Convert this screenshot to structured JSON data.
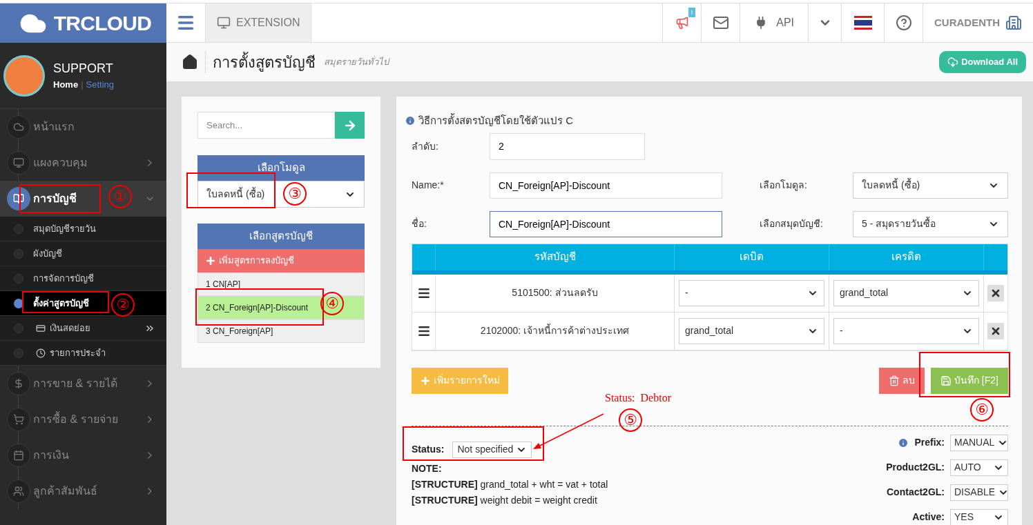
{
  "brand": {
    "name": "TRCLOUD"
  },
  "topbar": {
    "tab": "EXTENSION",
    "notification_badge": "!",
    "api_label": "API",
    "company": "CURADENTH"
  },
  "profile": {
    "name": "SUPPORT",
    "separator": "|",
    "links": [
      {
        "label": "Home",
        "selected": true
      },
      {
        "label": "Setting",
        "selected": false
      }
    ]
  },
  "sidebar": {
    "items": [
      {
        "label": "หน้าแรก",
        "expanded": false,
        "has_arrow": false
      },
      {
        "label": "แผงควบคุม",
        "expanded": false,
        "has_arrow": true
      },
      {
        "label": "การบัญชี",
        "expanded": true,
        "has_arrow": true,
        "children": [
          {
            "label": "สมุดบัญชีรายวัน",
            "selected": false,
            "kind": "plain"
          },
          {
            "label": "ผังบัญชี",
            "selected": false,
            "kind": "plain"
          },
          {
            "label": "การจัดการบัญชี",
            "selected": false,
            "kind": "plain"
          },
          {
            "label": "ตั้งค่าสูตรบัญชี",
            "selected": true,
            "kind": "plain"
          },
          {
            "label": "เงินสดย่อย",
            "selected": false,
            "kind": "card",
            "submenu": true
          },
          {
            "label": "รายการประจำ",
            "selected": false,
            "kind": "clock",
            "submenu": false
          }
        ]
      },
      {
        "label": "การขาย & รายได้",
        "expanded": false,
        "has_arrow": true
      },
      {
        "label": "การซื้อ & รายจ่าย",
        "expanded": false,
        "has_arrow": true
      },
      {
        "label": "การเงิน",
        "expanded": false,
        "has_arrow": true
      },
      {
        "label": "ลูกค้าสัมพันธ์",
        "expanded": false,
        "has_arrow": true
      }
    ]
  },
  "page_header": {
    "title": "การตั้งสูตรบัญชี",
    "subtitle": "สมุดรายวันทั่วไป",
    "download_button": "Download All"
  },
  "left_panel": {
    "search": {
      "placeholder": "Search..."
    },
    "module": {
      "heading": "เลือกโมดูล",
      "value": "ใบลดหนี้ (ซื้อ)"
    },
    "formulas": {
      "heading": "เลือกสูตรบัญชี",
      "add_button": "เพิ่มสูตรการลงบัญชี",
      "items": [
        {
          "label": "1 CN[AP]",
          "selected": false
        },
        {
          "label": "2 CN_Foreign[AP]-Discount",
          "selected": true
        },
        {
          "label": "3 CN_Foreign[AP]",
          "selected": false
        }
      ]
    }
  },
  "form": {
    "info": "วิธีการตั้งสตรบัญชีโดยใช้ตัวแปร C",
    "order": {
      "label": "ลำดับ:",
      "value": "2"
    },
    "name": {
      "label": "Name:*",
      "value": "CN_Foreign[AP]-Discount"
    },
    "module": {
      "label": "เลือกโมดูล:",
      "value": "ใบลดหนี้ (ซื้อ)"
    },
    "thai_name": {
      "label": "ชื่อ:",
      "value": "CN_Foreign[AP]-Discount",
      "focused": true
    },
    "journal": {
      "label": "เลือกสมุดบัญชี:",
      "value": "5 - สมุดรายวันซื้อ"
    }
  },
  "table": {
    "columns": [
      "รหัสบัญชี",
      "เดบิต",
      "เครดิต"
    ],
    "rows": [
      {
        "account": "5101500: ส่วนลดรับ",
        "debit": "-",
        "credit": "grand_total"
      },
      {
        "account": "2102000: เจ้าหนี้การค้าต่างประเทศ",
        "debit": "grand_total",
        "credit": "-"
      }
    ]
  },
  "buttons": {
    "add_row": "เพิ่มรายการใหม่",
    "delete": "ลบ",
    "save": "บันทึก [F2]"
  },
  "status": {
    "label": "Status:",
    "value": "Not specified"
  },
  "notes": [
    "NOTE:",
    "**[STRUCTURE]** grand_total + wht = vat + total",
    "**[STRUCTURE]** weight debit = weight credit"
  ],
  "settings": [
    {
      "label": "Prefix:",
      "value": "MANUAL",
      "kind": "info"
    },
    {
      "label": "Product2GL:",
      "value": "AUTO",
      "kind": "plain"
    },
    {
      "label": "Contact2GL:",
      "value": "DISABLE",
      "kind": "plain"
    },
    {
      "label": "Active:",
      "value": "YES",
      "kind": "plain"
    }
  ],
  "annotations": {
    "markers": [
      "①",
      "②",
      "③",
      "④",
      "⑤",
      "⑥"
    ],
    "note": "Status:  Debtor"
  }
}
